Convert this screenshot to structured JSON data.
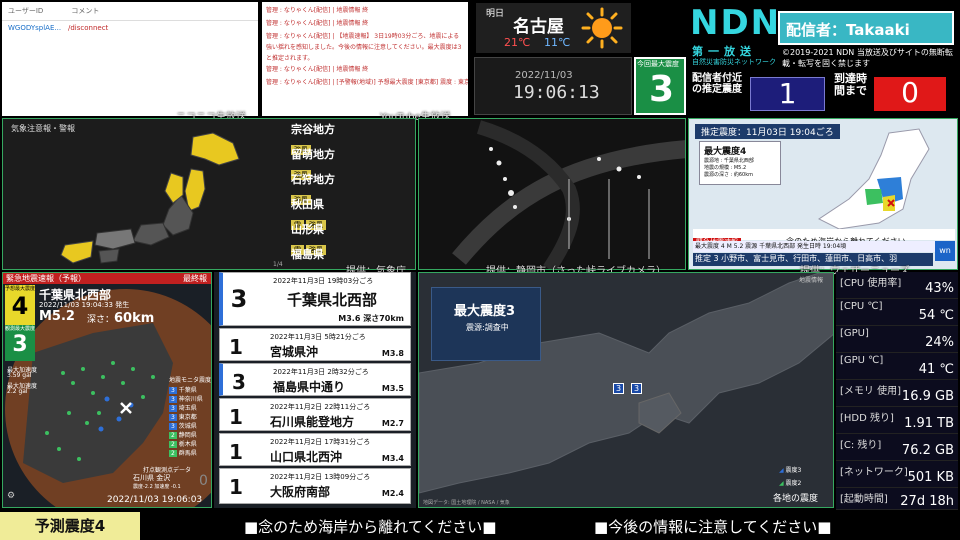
{
  "chat_niconico": {
    "header_user": "ユーザーID",
    "header_comment": "コメント",
    "rows": [
      {
        "user": "WGODYsplAE...",
        "comment": "/disconnect"
      }
    ],
    "caption": "ニコニコ生放送"
  },
  "chat_youtube": {
    "lines": [
      "管理 : なりゃくん[配信] | 地震情報 終",
      "管理 : なりゃくん[配信] | 地震情報 終",
      "管理 : なりゃくん[配信] | 【地震速報】 3日19時03分ごろ、地震による強い揺れを感知しました。今後の情報に注意してください。最大震度は3と推定されます。",
      "管理 : なりゃくん[配信] | 地震情報 終",
      "管理 : なりゃくん[配信] | [予警報(地域)] 予想最大震度 [東京都] 震度 : 東京都23区"
    ],
    "caption": "YouTube生放送"
  },
  "weather": {
    "day": "明日",
    "city": "名古屋",
    "high": "21℃",
    "low": "11℃",
    "icon": "sun-icon"
  },
  "clock": {
    "date": "2022/11/03",
    "time": "19:06:13",
    "max_label": "今回最大震度",
    "max_value": "3"
  },
  "ndn": {
    "logo": "NDN",
    "broadcaster": "配信者：Takaaki",
    "sub1": "第一放送",
    "sub2": "自然災害防災ネットワーク",
    "copyright": "©2019-2021 NDN 当放送及びサイトの無断転載・転写を固く禁じます",
    "est_label": "配信者付近の推定震度",
    "est_value": "1",
    "arrival_label": "到達時間まで",
    "arrival_value": "0"
  },
  "warning_map": {
    "title": "気象注意報・警報",
    "regions": [
      {
        "name": "宗谷地方",
        "badges": [
          "強風"
        ]
      },
      {
        "name": "留萌地方",
        "badges": [
          "強風"
        ]
      },
      {
        "name": "石狩地方",
        "badges": [
          "強風"
        ]
      },
      {
        "name": "秋田県",
        "badges": [
          "雷",
          "強風"
        ]
      },
      {
        "name": "山形県",
        "badges": [
          "雷",
          "強風"
        ]
      },
      {
        "name": "福島県",
        "badges": [
          "強風"
        ]
      }
    ],
    "page": "1/4",
    "credit": "提供：気象庁"
  },
  "camera": {
    "credit": "提供：静岡市（さった峠ライブカメラ）"
  },
  "weathernews": {
    "header": "推定震度：11月03日 19:04ごろ",
    "box_title": "最大震度4",
    "box_lines": [
      "震源地 : 千葉県北西部",
      "地震の規模 : M5.2",
      "震源の深さ : 約60km"
    ],
    "eew_label": "緊急地震速報",
    "eew_message": "念のため海岸から離れてください",
    "eew_row1": "最大震度 4  M 5.2  震源 千葉県北西部  発生日時 19:04頃",
    "eew_row2": "推定 3 小野市、富士見市、行田市、蓮田市、日高市、羽",
    "credit": "提供：ウェザーニューズ"
  },
  "eew": {
    "header": "緊急地震速報（予報）",
    "final": "最終報",
    "pred_label": "予想最大震度",
    "pred_value": "4",
    "region": "千葉県北西部",
    "time": "2022/11/03 19:04:33 発生",
    "magnitude": "M5.2",
    "depth_label": "深さ：",
    "depth_value": "60km",
    "obs_label": "観測最大震度",
    "obs_value": "3",
    "accel_label": "最大加速度",
    "accel_value": "3.59 gal",
    "pga_label": "最大加速度",
    "pga_value": "2.2 gal",
    "legend_title": "地震モニタ震度",
    "legend": [
      {
        "int": "3",
        "place": "千葉県"
      },
      {
        "int": "3",
        "place": "神奈川県"
      },
      {
        "int": "3",
        "place": "埼玉県"
      },
      {
        "int": "3",
        "place": "東京都"
      },
      {
        "int": "3",
        "place": "茨城県"
      },
      {
        "int": "2",
        "place": "静岡県"
      },
      {
        "int": "2",
        "place": "栃木県"
      },
      {
        "int": "2",
        "place": "群馬県"
      }
    ],
    "foot_label": "打点観測点データ",
    "foot_place": "石川県 金沢",
    "foot_values": "震度-2.2 加速度 -0.1",
    "foot_zero": "0",
    "timestamp": "2022/11/03 19:06:03"
  },
  "quake_list": [
    {
      "int": "3",
      "time": "2022年11月3日 19時03分ごろ",
      "place": "千葉県北西部",
      "mag": "M3.6 深さ70km"
    },
    {
      "int": "1",
      "time": "2022年11月3日 5時21分ごろ",
      "place": "宮城県沖",
      "mag": "M3.8"
    },
    {
      "int": "3",
      "time": "2022年11月3日 2時32分ごろ",
      "place": "福島県中通り",
      "mag": "M3.5"
    },
    {
      "int": "1",
      "time": "2022年11月2日 22時11分ごろ",
      "place": "石川県能登地方",
      "mag": "M2.7"
    },
    {
      "int": "1",
      "time": "2022年11月2日 17時31分ごろ",
      "place": "山口県北西沖",
      "mag": "M3.4"
    },
    {
      "int": "1",
      "time": "2022年11月2日 13時09分ごろ",
      "place": "大阪府南部",
      "mag": "M2.4"
    }
  ],
  "quake_map": {
    "tag": "地震情報",
    "title": "最大震度3",
    "sub": "震源:調査中",
    "markers": [
      "3",
      "3"
    ],
    "legend": [
      "震度3",
      "震度2"
    ],
    "caption": "各地の震度",
    "footer": "地図データ: 国土地理院 / NASA / 気象"
  },
  "stats": [
    {
      "label": "[CPU 使用率]",
      "value": "43%"
    },
    {
      "label": "[CPU ℃]",
      "value": "54 ℃"
    },
    {
      "label": "[GPU]",
      "value": "24%"
    },
    {
      "label": "[GPU ℃]",
      "value": "41 ℃"
    },
    {
      "label": "[メモリ 使用]",
      "value": "16.9 GB"
    },
    {
      "label": "[HDD 残り]",
      "value": "1.91 TB"
    },
    {
      "label": "[C: 残り]",
      "value": "76.2 GB"
    },
    {
      "label": "[ネットワーク]",
      "value": "501 KB"
    },
    {
      "label": "[起動時間]",
      "value": "27d 18h"
    }
  ],
  "bottom": {
    "pred": "予測震度4",
    "msg1": "■念のため海岸から離れてください■",
    "msg2": "■今後の情報に注意してください■"
  },
  "colors": {
    "accent_green": "#35a860",
    "warning_yellow": "#e8c820",
    "ndn_cyan": "#35d7e0",
    "intensity3": "#1a3a8a"
  }
}
